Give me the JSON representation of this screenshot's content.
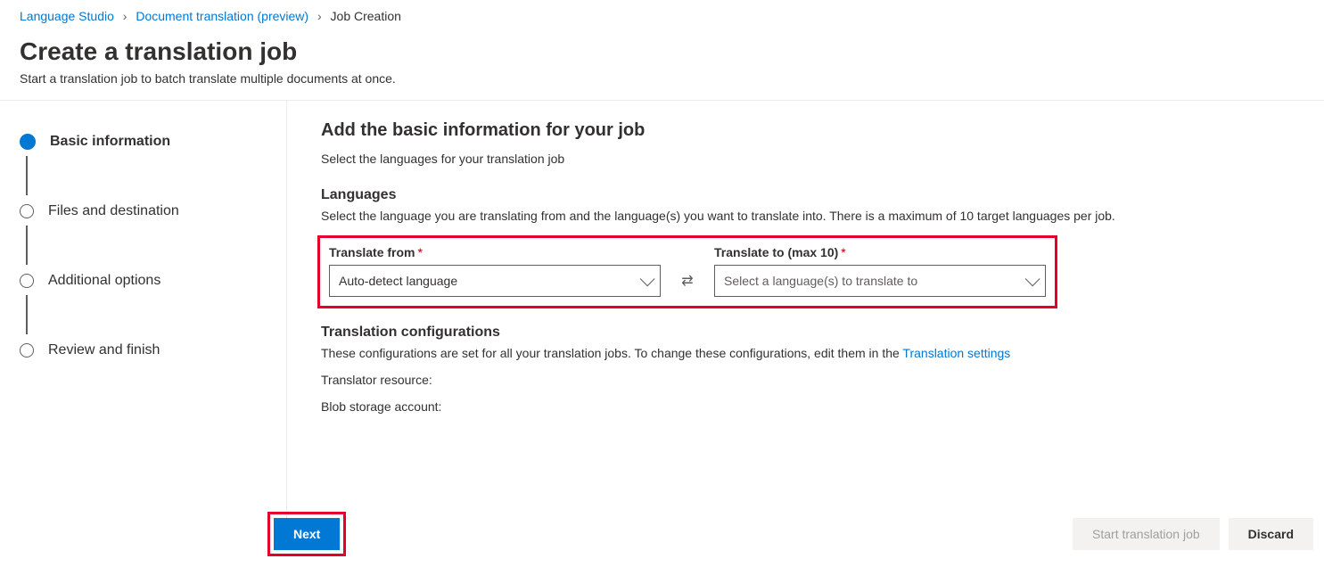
{
  "breadcrumb": {
    "items": [
      {
        "label": "Language Studio",
        "link": true
      },
      {
        "label": "Document translation (preview)",
        "link": true
      },
      {
        "label": "Job Creation",
        "link": false
      }
    ]
  },
  "page": {
    "title": "Create a translation job",
    "subtitle": "Start a translation job to batch translate multiple documents at once."
  },
  "stepper": {
    "steps": [
      {
        "label": "Basic information",
        "active": true
      },
      {
        "label": "Files and destination",
        "active": false
      },
      {
        "label": "Additional options",
        "active": false
      },
      {
        "label": "Review and finish",
        "active": false
      }
    ]
  },
  "main": {
    "heading": "Add the basic information for your job",
    "subtitle": "Select the languages for your translation job",
    "languages": {
      "section_title": "Languages",
      "section_desc": "Select the language you are translating from and the language(s) you want to translate into. There is a maximum of 10 target languages per job.",
      "from_label": "Translate from",
      "from_value": "Auto-detect language",
      "to_label": "Translate to (max 10)",
      "to_placeholder": "Select a language(s) to translate to"
    },
    "config": {
      "section_title": "Translation configurations",
      "desc_prefix": "These configurations are set for all your translation jobs. To change these configurations, edit them in the ",
      "link_text": "Translation settings",
      "resource_label": "Translator resource:",
      "storage_label": "Blob storage account:"
    }
  },
  "footer": {
    "next": "Next",
    "start": "Start translation job",
    "discard": "Discard"
  }
}
